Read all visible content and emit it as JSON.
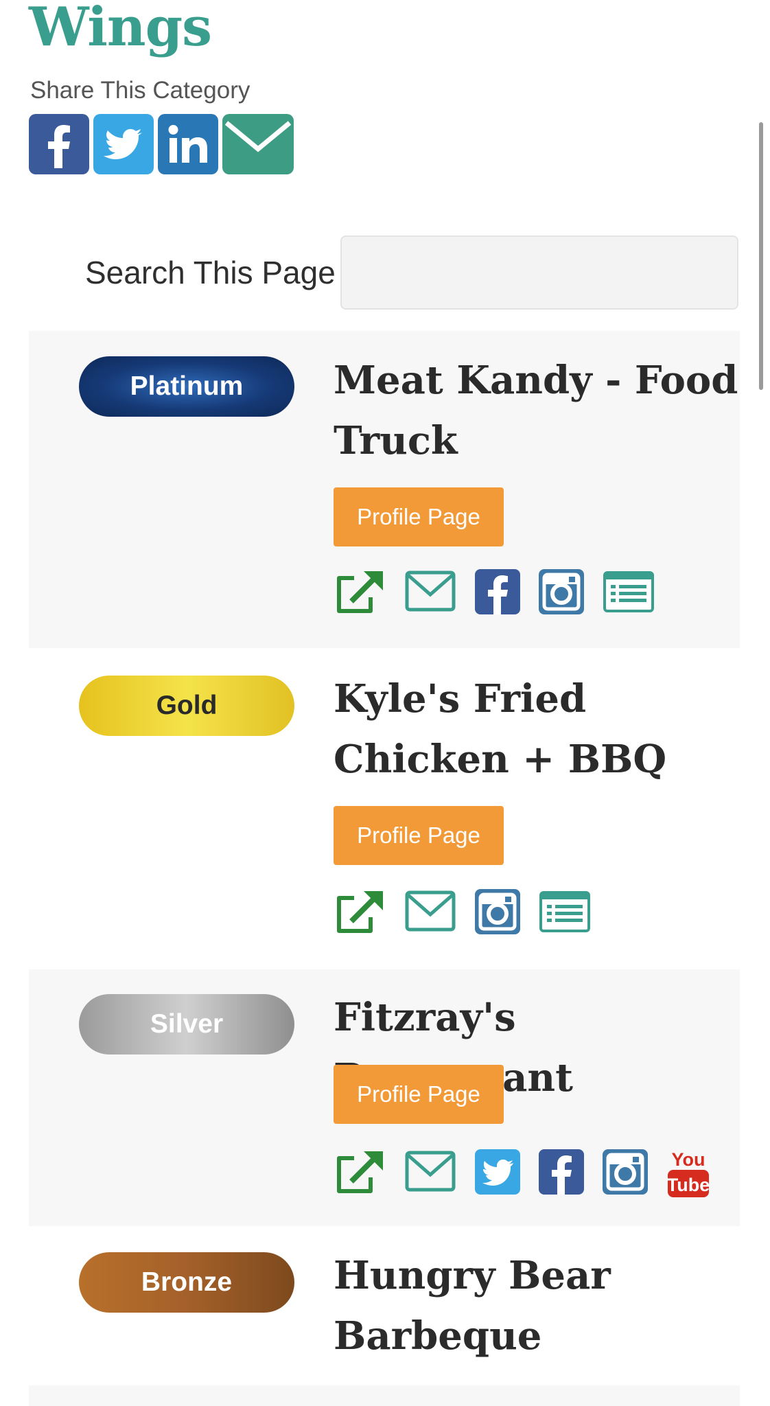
{
  "page": {
    "title": "Wings",
    "share_label": "Share This Category"
  },
  "share_icons": [
    "facebook-icon",
    "twitter-icon",
    "linkedin-icon",
    "email-icon"
  ],
  "search": {
    "label": "Search This Page",
    "value": "",
    "placeholder": ""
  },
  "listings": [
    {
      "tier": "Platinum",
      "name": "Meat Kandy - Food Truck",
      "profile_label": "Profile Page",
      "icons": [
        "external-link-icon",
        "email-icon",
        "facebook-icon",
        "instagram-icon",
        "menu-list-icon"
      ]
    },
    {
      "tier": "Gold",
      "name": "Kyle's Fried Chicken + BBQ",
      "profile_label": "Profile Page",
      "icons": [
        "external-link-icon",
        "email-icon",
        "instagram-icon",
        "menu-list-icon"
      ]
    },
    {
      "tier": "Silver",
      "name": "Fitzray's Restaurant",
      "profile_label": "Profile Page",
      "icons": [
        "external-link-icon",
        "email-icon",
        "twitter-icon",
        "facebook-icon",
        "instagram-icon",
        "youtube-icon"
      ]
    },
    {
      "tier": "Bronze",
      "name": "Hungry Bear Barbeque"
    }
  ],
  "colors": {
    "title": "#3a9e8e",
    "profile_button": "#f39a38",
    "external_link": "#2e8b3a",
    "email_outline": "#3a9e8e",
    "facebook": "#3b5a99",
    "twitter": "#3aa7e5",
    "linkedin": "#2a77b5",
    "instagram": "#3f79a8",
    "youtube": "#d62c20",
    "platinum": "#163a77",
    "gold": "#f0d83a",
    "silver": "#b5b5b5",
    "bronze": "#a4602a"
  }
}
